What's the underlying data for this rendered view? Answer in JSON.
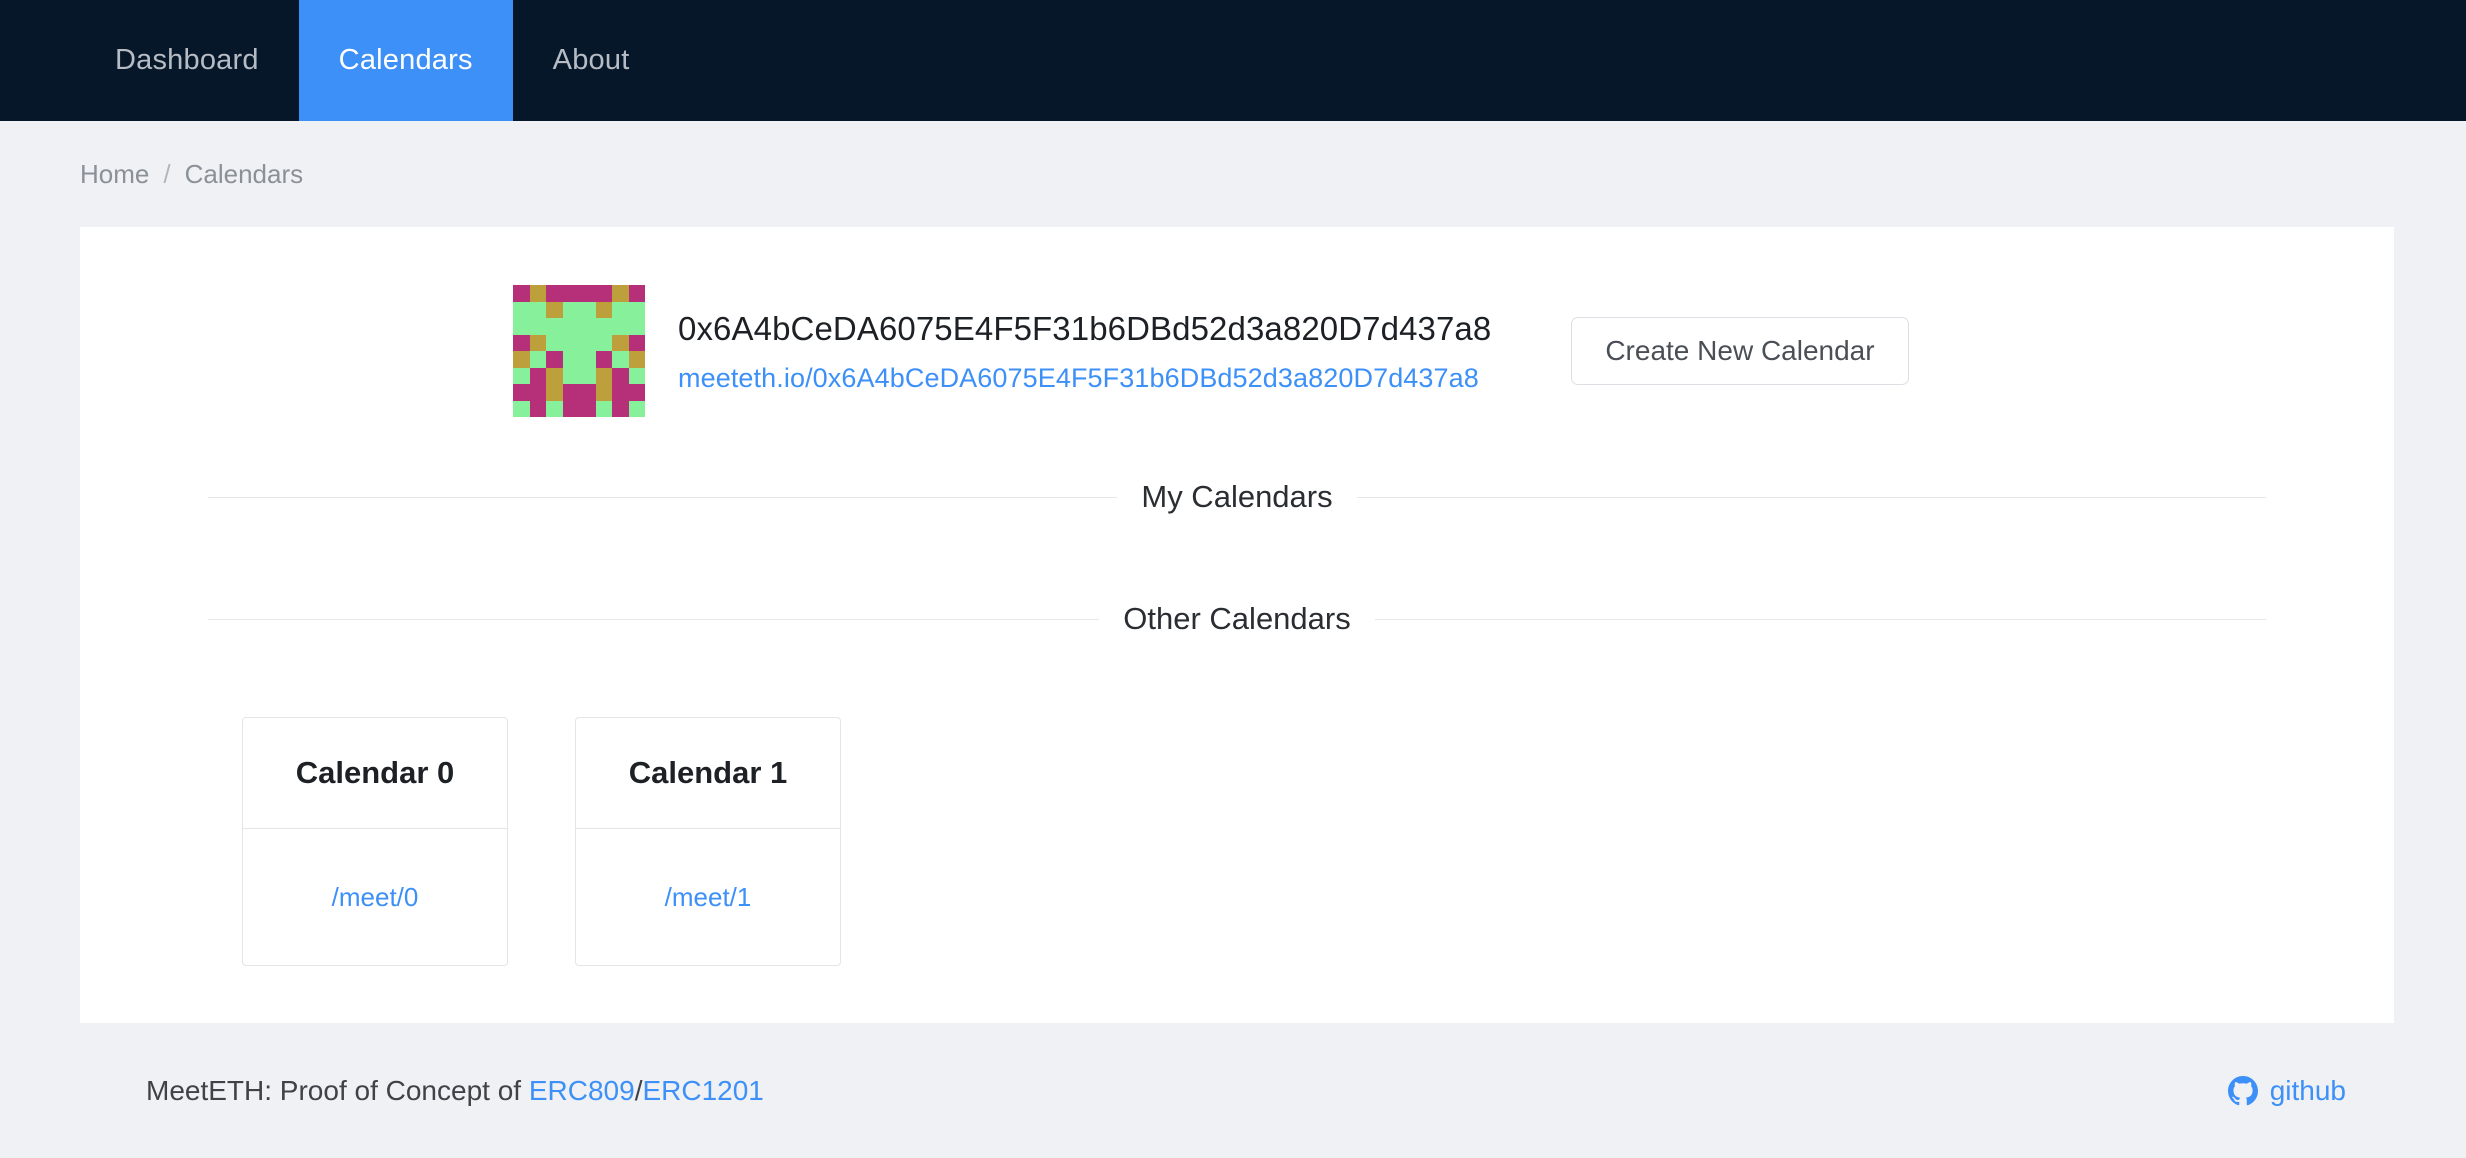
{
  "nav": {
    "items": [
      {
        "label": "Dashboard",
        "active": false
      },
      {
        "label": "Calendars",
        "active": true
      },
      {
        "label": "About",
        "active": false
      }
    ]
  },
  "breadcrumb": {
    "home": "Home",
    "separator": "/",
    "current": "Calendars"
  },
  "account": {
    "address": "0x6A4bCeDA6075E4F5F31b6DBd52d3a820D7d437a8",
    "profile_url": "meeteth.io/0x6A4bCeDA6075E4F5F31b6DBd52d3a820D7d437a8",
    "identicon_name": "blockies-identicon",
    "identicon_colors": {
      "green": "#86f09a",
      "pink": "#b52f79",
      "yellow": "#bda03c"
    },
    "identicon_grid": [
      [
        "pink",
        "yellow",
        "pink",
        "pink",
        "pink",
        "pink",
        "yellow",
        "pink"
      ],
      [
        "green",
        "green",
        "yellow",
        "green",
        "green",
        "yellow",
        "green",
        "green"
      ],
      [
        "green",
        "green",
        "green",
        "green",
        "green",
        "green",
        "green",
        "green"
      ],
      [
        "pink",
        "yellow",
        "green",
        "green",
        "green",
        "green",
        "yellow",
        "pink"
      ],
      [
        "yellow",
        "green",
        "pink",
        "green",
        "green",
        "pink",
        "green",
        "yellow"
      ],
      [
        "green",
        "pink",
        "yellow",
        "green",
        "green",
        "yellow",
        "pink",
        "green"
      ],
      [
        "pink",
        "pink",
        "yellow",
        "pink",
        "pink",
        "yellow",
        "pink",
        "pink"
      ],
      [
        "green",
        "pink",
        "green",
        "pink",
        "pink",
        "green",
        "pink",
        "green"
      ]
    ]
  },
  "actions": {
    "create_calendar": "Create New Calendar"
  },
  "sections": {
    "my_calendars": "My Calendars",
    "other_calendars": "Other Calendars"
  },
  "my_calendars": [],
  "other_calendars": [
    {
      "title": "Calendar 0",
      "link": "/meet/0"
    },
    {
      "title": "Calendar 1",
      "link": "/meet/1"
    }
  ],
  "footer": {
    "text_prefix": "MeetETH: Proof of Concept of ",
    "link1": "ERC809",
    "slash": "/",
    "link2": "ERC1201",
    "github_label": "github",
    "github_icon": "github-octocat-icon"
  },
  "theme": {
    "navbar_bg": "#07172a",
    "accent": "#3d90f7",
    "page_bg": "#f0f1f5",
    "panel_bg": "#ffffff"
  }
}
